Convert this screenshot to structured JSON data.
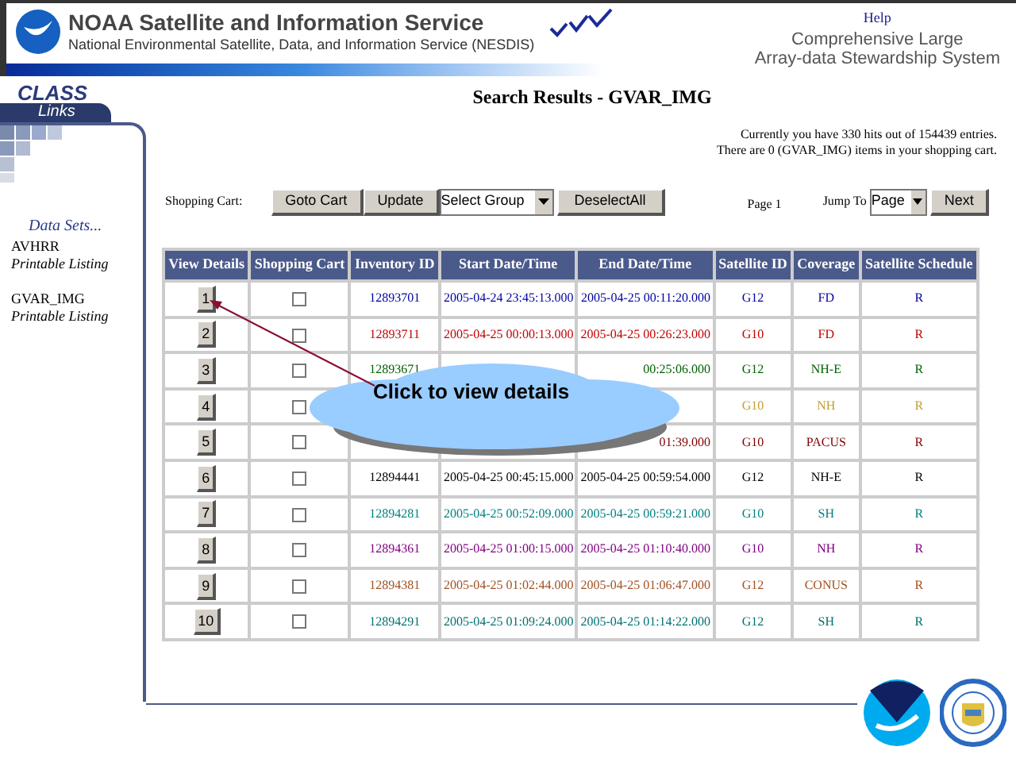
{
  "header": {
    "title": "NOAA Satellite and Information Service",
    "subtitle": "National Environmental Satellite, Data, and Information Service (NESDIS)",
    "help": "Help",
    "system_name": [
      "Comprehensive Large",
      "Array-data Stewardship System"
    ]
  },
  "sidebar": {
    "brand": "CLASS",
    "tab": "Links",
    "heading": "Data Sets...",
    "datasets": [
      {
        "name": "AVHRR",
        "link": "Printable Listing"
      },
      {
        "name": "GVAR_IMG",
        "link": "Printable Listing"
      }
    ]
  },
  "page_title": "Search Results - GVAR_IMG",
  "info": [
    "Currently you have 330 hits out of 154439 entries.",
    "There are 0 (GVAR_IMG) items in your shopping cart."
  ],
  "toolbar": {
    "label": "Shopping Cart:",
    "buttons": [
      "Goto Cart",
      "Update"
    ],
    "group_select": "Select Group",
    "deselect": "DeselectAll",
    "page": "Page 1",
    "jump_label": "Jump To",
    "page_select": "Page",
    "next": "Next"
  },
  "table": {
    "columns": [
      "View Details",
      "Shopping Cart",
      "Inventory ID",
      "Start Date/Time",
      "End Date/Time",
      "Satellite ID",
      "Coverage",
      "Satellite Schedule"
    ],
    "rows": [
      {
        "button": "1",
        "checked": false,
        "color": "#0000a0",
        "inventory": "12893701",
        "start": "2005-04-24 23:45:13.000",
        "end": "2005-04-25 00:11:20.000",
        "satellite": "G12",
        "coverage": "FD",
        "schedule": "R"
      },
      {
        "button": "2",
        "checked": false,
        "color": "#c00000",
        "inventory": "12893711",
        "start": "2005-04-25 00:00:13.000",
        "end": "2005-04-25 00:26:23.000",
        "satellite": "G10",
        "coverage": "FD",
        "schedule": "R"
      },
      {
        "button": "3",
        "checked": false,
        "color": "#006000",
        "inventory": "12893671",
        "end": "00:25:06.000",
        "satellite": "G12",
        "coverage": "NH-E",
        "schedule": "R"
      },
      {
        "button": "4",
        "checked": false,
        "color": "#c0a030",
        "satellite": "G10",
        "coverage": "NH",
        "schedule": "R"
      },
      {
        "button": "5",
        "checked": false,
        "color": "#800000",
        "end": "01:39.000",
        "satellite": "G10",
        "coverage": "PACUS",
        "schedule": "R"
      },
      {
        "button": "6",
        "checked": false,
        "color": "#000000",
        "inventory": "12894441",
        "start": "2005-04-25 00:45:15.000",
        "end": "2005-04-25 00:59:54.000",
        "satellite": "G12",
        "coverage": "NH-E",
        "schedule": "R"
      },
      {
        "button": "7",
        "checked": false,
        "color": "#008080",
        "inventory": "12894281",
        "start": "2005-04-25 00:52:09.000",
        "end": "2005-04-25 00:59:21.000",
        "satellite": "G10",
        "coverage": "SH",
        "schedule": "R"
      },
      {
        "button": "8",
        "checked": false,
        "color": "#800080",
        "inventory": "12894361",
        "start": "2005-04-25 01:00:15.000",
        "end": "2005-04-25 01:10:40.000",
        "satellite": "G10",
        "coverage": "NH",
        "schedule": "R"
      },
      {
        "button": "9",
        "checked": false,
        "color": "#a05020",
        "inventory": "12894381",
        "start": "2005-04-25 01:02:44.000",
        "end": "2005-04-25 01:06:47.000",
        "satellite": "G12",
        "coverage": "CONUS",
        "schedule": "R"
      },
      {
        "button": "10",
        "checked": false,
        "color": "#007070",
        "inventory": "12894291",
        "start": "2005-04-25 01:09:24.000",
        "end": "2005-04-25 01:14:22.000",
        "satellite": "G12",
        "coverage": "SH",
        "schedule": "R"
      }
    ]
  },
  "callout": "Click to view details"
}
